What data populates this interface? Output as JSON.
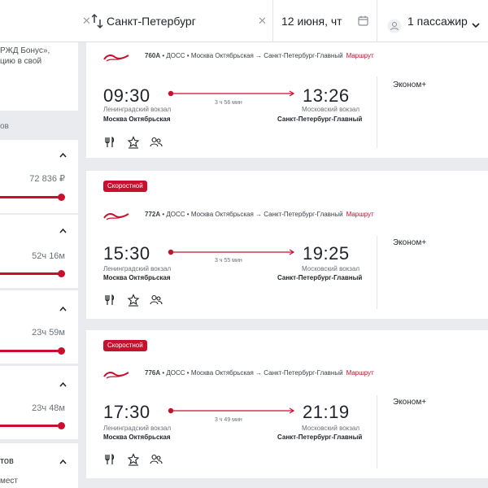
{
  "search": {
    "to_city": "Санкт-Петербург",
    "date": "12 июня, чт",
    "passengers": "1 пассажир",
    "clear_icon": "close-icon",
    "swap_icon": "swap-icon",
    "calendar_icon": "calendar-icon",
    "person_icon": "person-icon"
  },
  "sidebar": {
    "promo_lines": [
      "РЖД Бонус»,",
      "цию в свой"
    ],
    "tab_label": "ов",
    "filters": [
      {
        "value": "72 836 ₽"
      },
      {
        "value": "52ч 16м"
      },
      {
        "value": "23ч 59м"
      },
      {
        "value": "23ч 48м"
      }
    ],
    "last_filter_title": "тов",
    "last_filter_sub": "мест"
  },
  "cards": [
    {
      "badge": "",
      "train_number": "760А",
      "carrier": "ДОСС",
      "route_text": "Москва Октябрьская → Санкт-Петербург-Главный",
      "route_link": "Маршрут",
      "dep_time": "09:30",
      "arr_time": "13:26",
      "duration": "3 ч 56 мин",
      "dep_station": "Ленинградский вокзал",
      "dep_city": "Москва Октябрьская",
      "arr_station": "Московский вокзал",
      "arr_city": "Санкт-Петербург-Главный",
      "class": "Эконом+"
    },
    {
      "badge": "Скоростной",
      "train_number": "772А",
      "carrier": "ДОСС",
      "route_text": "Москва Октябрьская → Санкт-Петербург-Главный",
      "route_link": "Маршрут",
      "dep_time": "15:30",
      "arr_time": "19:25",
      "duration": "3 ч 55 мин",
      "dep_station": "Ленинградский вокзал",
      "dep_city": "Москва Октябрьская",
      "arr_station": "Московский вокзал",
      "arr_city": "Санкт-Петербург-Главный",
      "class": "Эконом+"
    },
    {
      "badge": "Скоростной",
      "train_number": "776А",
      "carrier": "ДОСС",
      "route_text": "Москва Октябрьская → Санкт-Петербург-Главный",
      "route_link": "Маршрут",
      "dep_time": "17:30",
      "arr_time": "21:19",
      "duration": "3 ч 49 мин",
      "dep_station": "Ленинградский вокзал",
      "dep_city": "Москва Октябрьская",
      "arr_station": "Московский вокзал",
      "arr_city": "Санкт-Петербург-Главный",
      "class": "Эконом+"
    }
  ],
  "colors": {
    "accent": "#c8102e",
    "background": "#e9ebee",
    "card": "#ffffff"
  }
}
